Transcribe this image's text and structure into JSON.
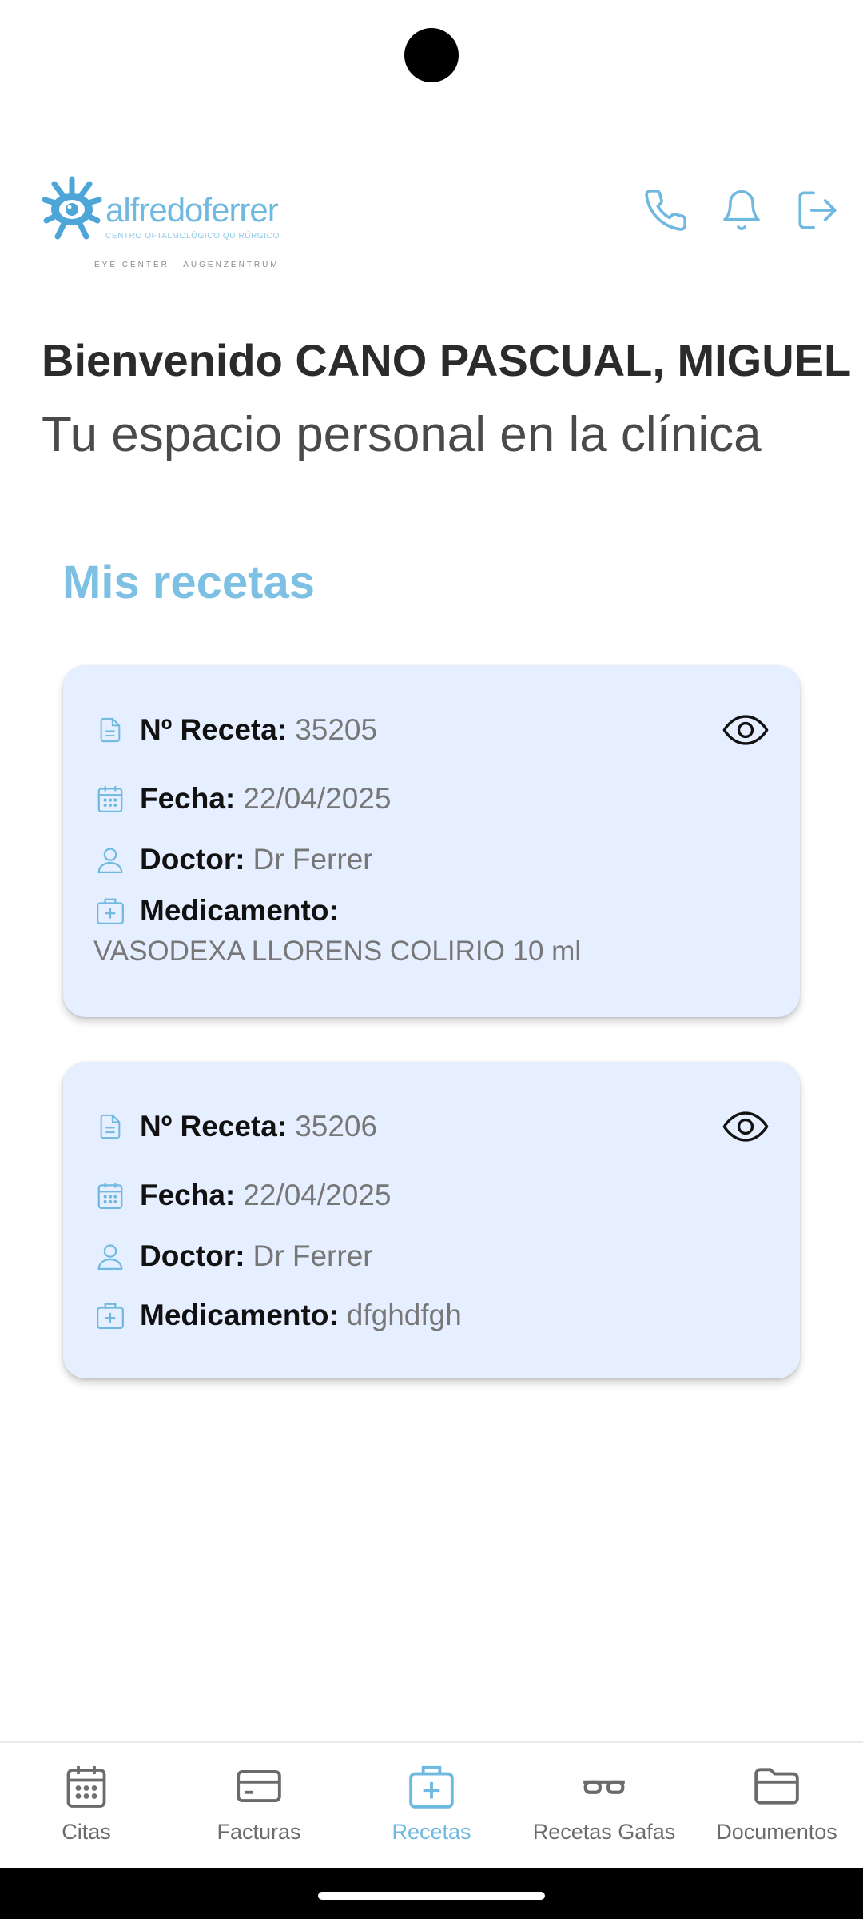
{
  "header": {
    "logo": {
      "wordmark": "alfredoferrer",
      "tagline": "CENTRO OFTALMOLÓGICO QUIRÚRGICO",
      "subtagline": "EYE CENTER · AUGENZENTRUM"
    },
    "icons": [
      "phone-icon",
      "bell-icon",
      "logout-icon"
    ]
  },
  "welcome": {
    "title": "Bienvenido CANO PASCUAL, MIGUEL",
    "subtitle": "Tu espacio personal en la clínica"
  },
  "section": {
    "title": "Mis recetas"
  },
  "prescriptions": [
    {
      "number_label": "Nº Receta:",
      "number": "35205",
      "date_label": "Fecha:",
      "date": "22/04/2025",
      "doctor_label": "Doctor:",
      "doctor": "Dr Ferrer",
      "medication_label": "Medicamento:",
      "medication": "VASODEXA LLORENS COLIRIO 10 ml"
    },
    {
      "number_label": "Nº Receta:",
      "number": "35206",
      "date_label": "Fecha:",
      "date": "22/04/2025",
      "doctor_label": "Doctor:",
      "doctor": "Dr Ferrer",
      "medication_label": "Medicamento:",
      "medication": "dfghdfgh"
    }
  ],
  "bottom_nav": {
    "active": "Recetas",
    "items": [
      {
        "label": "Citas",
        "icon": "calendar-icon"
      },
      {
        "label": "Facturas",
        "icon": "credit-card-icon"
      },
      {
        "label": "Recetas",
        "icon": "medical-kit-icon"
      },
      {
        "label": "Recetas Gafas",
        "icon": "glasses-icon"
      },
      {
        "label": "Documentos",
        "icon": "folder-icon"
      }
    ]
  },
  "colors": {
    "accent": "#6fb8df",
    "card_background": "#e6efff",
    "label_text": "#111111",
    "value_text": "#777777",
    "nav_inactive": "#6b6b6b"
  }
}
